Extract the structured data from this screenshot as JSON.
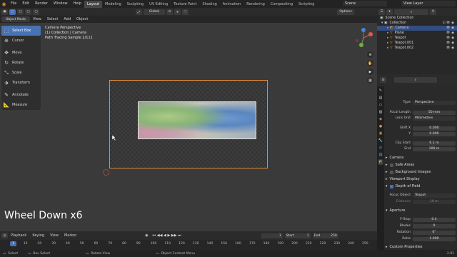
{
  "topbar": {
    "menus": [
      "File",
      "Edit",
      "Render",
      "Window",
      "Help"
    ],
    "workspaces": [
      "Layout",
      "Modeling",
      "Sculpting",
      "UV Editing",
      "Texture Paint",
      "Shading",
      "Animation",
      "Rendering",
      "Compositing",
      "Scripting"
    ],
    "active_workspace": "Layout",
    "scene": "Scene",
    "view_layer": "View Layer"
  },
  "viewport_header": {
    "mode": "Object Mode",
    "menus": [
      "View",
      "Select",
      "Add",
      "Object"
    ],
    "orientation": "Global",
    "options": "Options"
  },
  "camera_info": {
    "line1": "Camera Perspective",
    "line2": "(1) Collection | Camera",
    "line3": "Path Tracing Sample 2/111"
  },
  "tools": [
    "Select Box",
    "Cursor",
    "Move",
    "Rotate",
    "Scale",
    "Transform",
    "Annotate",
    "Measure"
  ],
  "overlay_text": "Wheel Down x6",
  "outliner": {
    "rows": [
      {
        "label": "Scene Collection"
      },
      {
        "label": "Collection"
      },
      {
        "label": "Camera"
      },
      {
        "label": "Plane"
      },
      {
        "label": "Teapot"
      },
      {
        "label": "Teapot.001"
      },
      {
        "label": "Teapot.002"
      }
    ]
  },
  "properties": {
    "type_label": "Type",
    "type_value": "Perspective",
    "focal_label": "Focal Length",
    "focal_value": "50 mm",
    "lens_unit_label": "Lens Unit",
    "lens_unit_value": "Millimeters",
    "shift_x_label": "Shift X",
    "shift_x_value": "0.000",
    "shift_y_label": "Y",
    "shift_y_value": "0.000",
    "clip_start_label": "Clip Start",
    "clip_start_value": "0.1 m",
    "clip_end_label": "End",
    "clip_end_value": "100 m",
    "camera_section": "Camera",
    "safe_areas": "Safe Areas",
    "bg_images": "Background Images",
    "viewport_display": "Viewport Display",
    "dof": "Depth of Field",
    "focus_object_label": "Focus Object",
    "focus_object_value": "Teapot",
    "distance_label": "Distance",
    "distance_value": "10 m",
    "aperture": "Aperture",
    "fstop_label": "F-Stop",
    "fstop_value": "0.4",
    "blades_label": "Blades",
    "blades_value": "0",
    "rotation_label": "Rotation",
    "rotation_value": "0°",
    "ratio_label": "Ratio",
    "ratio_value": "1.000",
    "custom_props": "Custom Properties"
  },
  "timeline": {
    "menus": [
      "Playback",
      "Keying",
      "View",
      "Marker"
    ],
    "current_frame": "1",
    "start_label": "Start",
    "start_value": "1",
    "end_label": "End",
    "end_value": "250",
    "ticks": [
      "1",
      "10",
      "20",
      "30",
      "40",
      "50",
      "60",
      "70",
      "80",
      "90",
      "100",
      "110",
      "120",
      "130",
      "140",
      "150",
      "160",
      "170",
      "180",
      "190",
      "200",
      "210",
      "220",
      "230",
      "240",
      "250"
    ]
  },
  "statusbar": {
    "items": [
      "Select",
      "Box Select",
      "Rotate View",
      "Object Context Menu"
    ],
    "version": "2.91"
  },
  "colors": {
    "accent": "#4772b3",
    "camera_frame": "#e08a3a",
    "selected_row": "#334d80"
  }
}
